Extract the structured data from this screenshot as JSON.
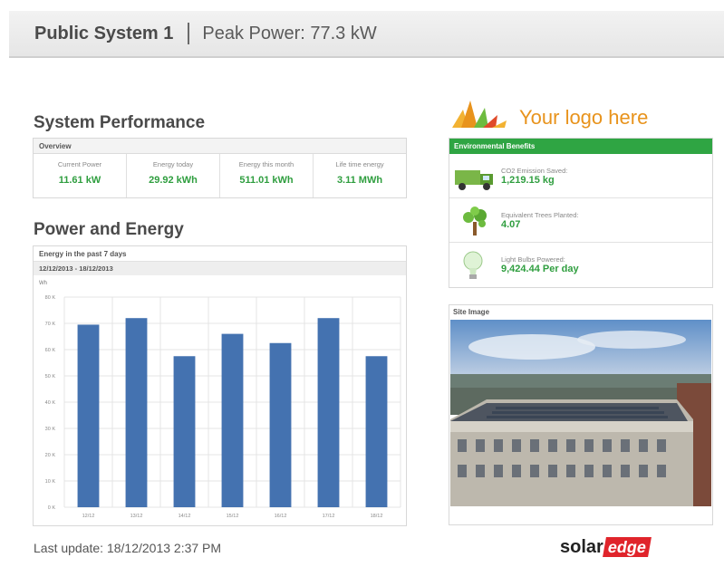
{
  "header": {
    "system_name": "Public System 1",
    "peak_power": "Peak Power: 77.3 kW"
  },
  "performance": {
    "title": "System Performance",
    "overview_label": "Overview",
    "metrics": [
      {
        "label": "Current Power",
        "value": "11.61 kW"
      },
      {
        "label": "Energy today",
        "value": "29.92 kWh"
      },
      {
        "label": "Energy this month",
        "value": "511.01 kWh"
      },
      {
        "label": "Life time energy",
        "value": "3.11 MWh"
      }
    ]
  },
  "energy": {
    "title": "Power and Energy",
    "box_label": "Energy in the past 7 days",
    "date_range": "12/12/2013 - 18/12/2013"
  },
  "chart_data": {
    "type": "bar",
    "ylabel": "Wh",
    "categories": [
      "12/12",
      "13/12",
      "14/12",
      "15/12",
      "16/12",
      "17/12",
      "18/12"
    ],
    "values": [
      69500,
      72000,
      57500,
      66000,
      62500,
      72000,
      57500
    ],
    "ylim": [
      0,
      80000
    ],
    "yticks": [
      0,
      10000,
      20000,
      30000,
      40000,
      50000,
      60000,
      70000,
      80000
    ],
    "ytick_labels": [
      "0 K",
      "10 K",
      "20 K",
      "30 K",
      "40 K",
      "50 K",
      "60 K",
      "70 K",
      "80 K"
    ],
    "color": "#4472b0",
    "grid": true
  },
  "logo": {
    "text": "Your logo here",
    "color": "#e8931c"
  },
  "environmental": {
    "title": "Environmental Benefits",
    "items": [
      {
        "icon": "truck-icon",
        "label": "CO2 Emission Saved:",
        "value": "1,219.15 kg"
      },
      {
        "icon": "tree-icon",
        "label": "Equivalent Trees Planted:",
        "value": "4.07"
      },
      {
        "icon": "light-bulb-icon",
        "label": "Light Bulbs Powered:",
        "value": "9,424.44 Per day"
      }
    ],
    "accent": "#2fa543"
  },
  "site_image": {
    "title": "Site Image"
  },
  "footer": {
    "last_update": "Last update: 18/12/2013 2:37 PM",
    "brand_part1": "solar",
    "brand_part2": "edge",
    "brand_color": "#e0242b"
  }
}
